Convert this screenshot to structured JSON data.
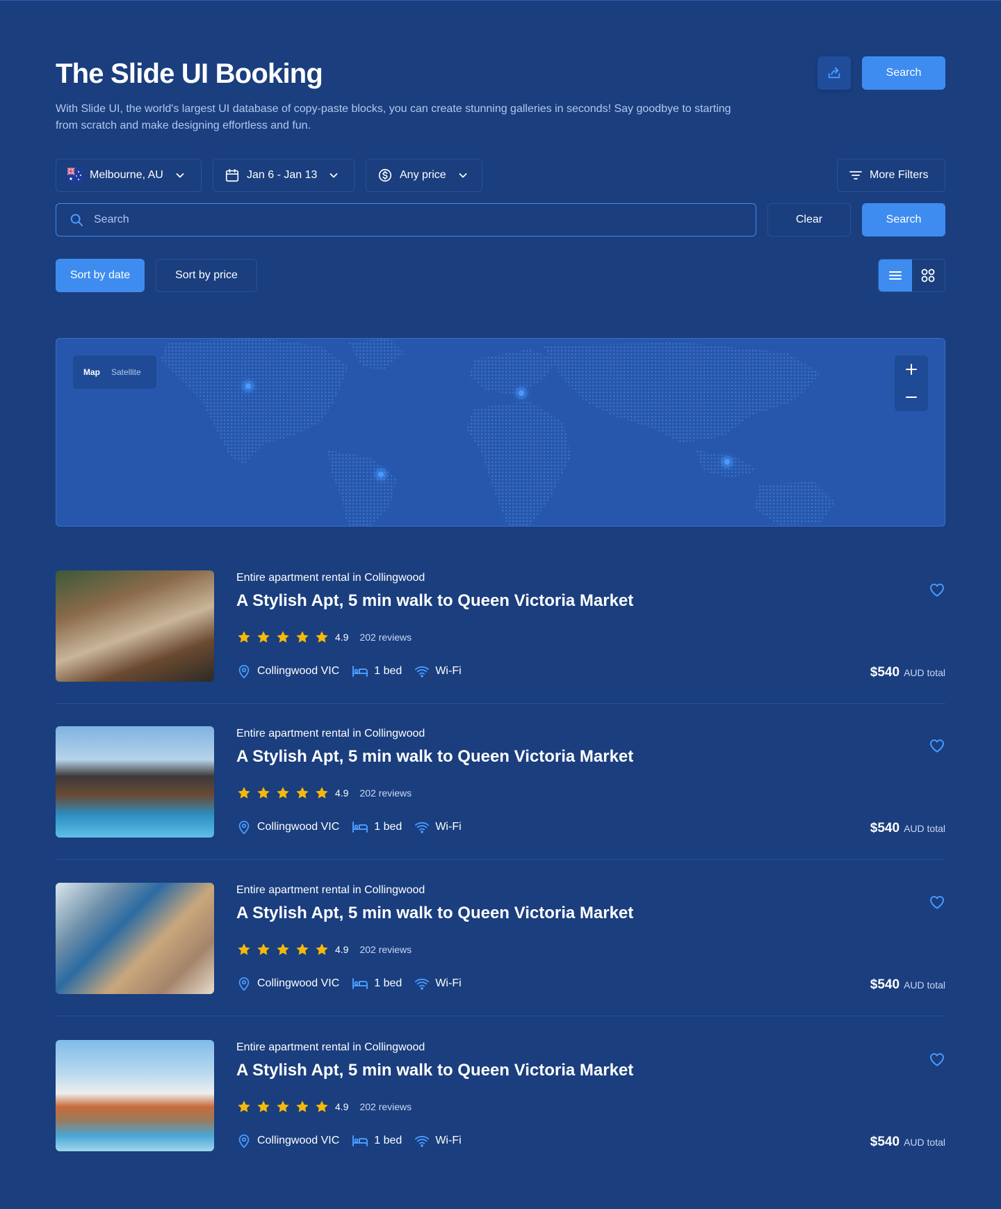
{
  "header": {
    "title": "The Slide UI Booking",
    "subtitle": "With Slide UI, the world's largest UI database of copy-paste blocks, you can create stunning galleries in seconds! Say goodbye to starting from scratch and make designing effortless and fun.",
    "share_icon": "share-icon",
    "search_label": "Search"
  },
  "filters": {
    "location": "Melbourne, AU",
    "location_icon": "australia-flag-icon",
    "dates": "Jan 6 - Jan 13",
    "price": "Any price",
    "more": "More Filters"
  },
  "search": {
    "placeholder": "Search",
    "value": "",
    "clear_label": "Clear",
    "submit_label": "Search"
  },
  "sort": {
    "by_date": "Sort by date",
    "by_price": "Sort by price",
    "active": "by_date"
  },
  "view": {
    "active": "list"
  },
  "map": {
    "mode_map": "Map",
    "mode_satellite": "Satellite",
    "active_mode": "Map",
    "zoom_in": "+",
    "zoom_out": "−"
  },
  "colors": {
    "background": "#1a3e7e",
    "accent": "#3e8cf0",
    "star": "#f5b90b",
    "map": "#2657ad"
  },
  "listings": [
    {
      "kicker": "Entire apartment rental in Collingwood",
      "title": "A Stylish Apt, 5 min walk to Queen Victoria Market",
      "stars": 5,
      "score": "4.9",
      "reviews": "202 reviews",
      "location": "Collingwood VIC",
      "beds": "1 bed",
      "wifi": "Wi-Fi",
      "price": "$540",
      "price_unit": "AUD total"
    },
    {
      "kicker": "Entire apartment rental in Collingwood",
      "title": "A Stylish Apt, 5 min walk to Queen Victoria Market",
      "stars": 5,
      "score": "4.9",
      "reviews": "202 reviews",
      "location": "Collingwood VIC",
      "beds": "1 bed",
      "wifi": "Wi-Fi",
      "price": "$540",
      "price_unit": "AUD total"
    },
    {
      "kicker": "Entire apartment rental in Collingwood",
      "title": "A Stylish Apt, 5 min walk to Queen Victoria Market",
      "stars": 5,
      "score": "4.9",
      "reviews": "202 reviews",
      "location": "Collingwood VIC",
      "beds": "1 bed",
      "wifi": "Wi-Fi",
      "price": "$540",
      "price_unit": "AUD total"
    },
    {
      "kicker": "Entire apartment rental in Collingwood",
      "title": "A Stylish Apt, 5 min walk to Queen Victoria Market",
      "stars": 5,
      "score": "4.9",
      "reviews": "202 reviews",
      "location": "Collingwood VIC",
      "beds": "1 bed",
      "wifi": "Wi-Fi",
      "price": "$540",
      "price_unit": "AUD total"
    }
  ]
}
